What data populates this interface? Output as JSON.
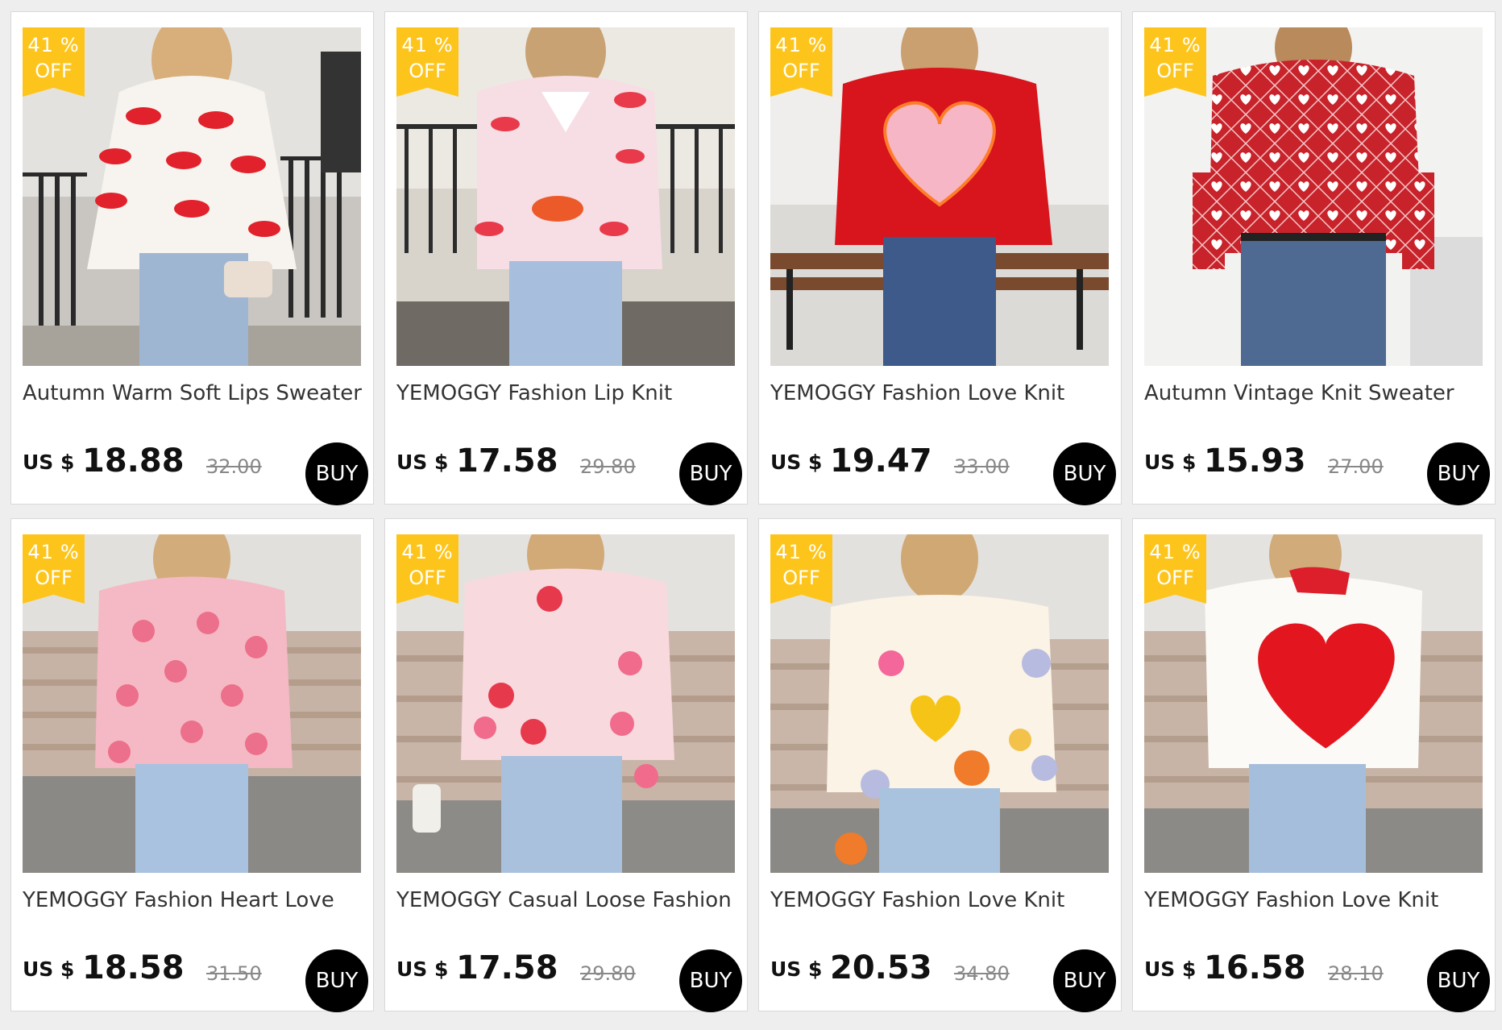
{
  "products": [
    {
      "title": "Autumn Warm Soft Lips Sweater",
      "currency": "US $",
      "price": "18.88",
      "original_price": "32.00",
      "discount_pct": "41",
      "discount_sym": "%",
      "discount_off": "OFF",
      "buy_label": "BUY"
    },
    {
      "title": "YEMOGGY Fashion Lip Knit",
      "currency": "US $",
      "price": "17.58",
      "original_price": "29.80",
      "discount_pct": "41",
      "discount_sym": "%",
      "discount_off": "OFF",
      "buy_label": "BUY"
    },
    {
      "title": "YEMOGGY Fashion Love Knit",
      "currency": "US $",
      "price": "19.47",
      "original_price": "33.00",
      "discount_pct": "41",
      "discount_sym": "%",
      "discount_off": "OFF",
      "buy_label": "BUY"
    },
    {
      "title": "Autumn Vintage Knit Sweater",
      "currency": "US $",
      "price": "15.93",
      "original_price": "27.00",
      "discount_pct": "41",
      "discount_sym": "%",
      "discount_off": "OFF",
      "buy_label": "BUY"
    },
    {
      "title": "YEMOGGY Fashion Heart Love",
      "currency": "US $",
      "price": "18.58",
      "original_price": "31.50",
      "discount_pct": "41",
      "discount_sym": "%",
      "discount_off": "OFF",
      "buy_label": "BUY"
    },
    {
      "title": "YEMOGGY Casual Loose Fashion",
      "currency": "US $",
      "price": "17.58",
      "original_price": "29.80",
      "discount_pct": "41",
      "discount_sym": "%",
      "discount_off": "OFF",
      "buy_label": "BUY"
    },
    {
      "title": "YEMOGGY Fashion Love Knit",
      "currency": "US $",
      "price": "20.53",
      "original_price": "34.80",
      "discount_pct": "41",
      "discount_sym": "%",
      "discount_off": "OFF",
      "buy_label": "BUY"
    },
    {
      "title": "YEMOGGY Fashion Love Knit",
      "currency": "US $",
      "price": "16.58",
      "original_price": "28.10",
      "discount_pct": "41",
      "discount_sym": "%",
      "discount_off": "OFF",
      "buy_label": "BUY"
    }
  ]
}
